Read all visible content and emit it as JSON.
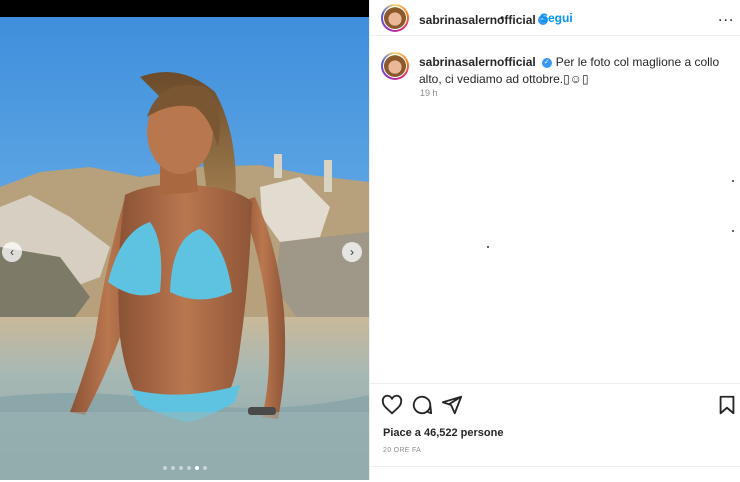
{
  "post": {
    "username": "sabrinasalernofficial",
    "separator": "•",
    "follow_label": "Segui",
    "more_label": "...",
    "caption": "Per le foto col maglione a collo alto, ci vediamo ad ottobre.▯☺▯",
    "caption_time": "19 h",
    "likes": "Piace a 46,522 persone",
    "date": "20 ORE FA"
  },
  "media": {
    "prev_label": "‹",
    "next_label": "›",
    "slide_count": 6,
    "active_slide": 4
  },
  "colors": {
    "link": "#0095f6",
    "verified": "#3897f0",
    "sky": "#5aa8e6",
    "bikini": "#5ec3e0"
  },
  "icons": [
    "verified-badge-icon",
    "more-options-icon",
    "heart-icon",
    "comment-icon",
    "share-icon",
    "bookmark-icon",
    "chevron-left-icon",
    "chevron-right-icon"
  ]
}
